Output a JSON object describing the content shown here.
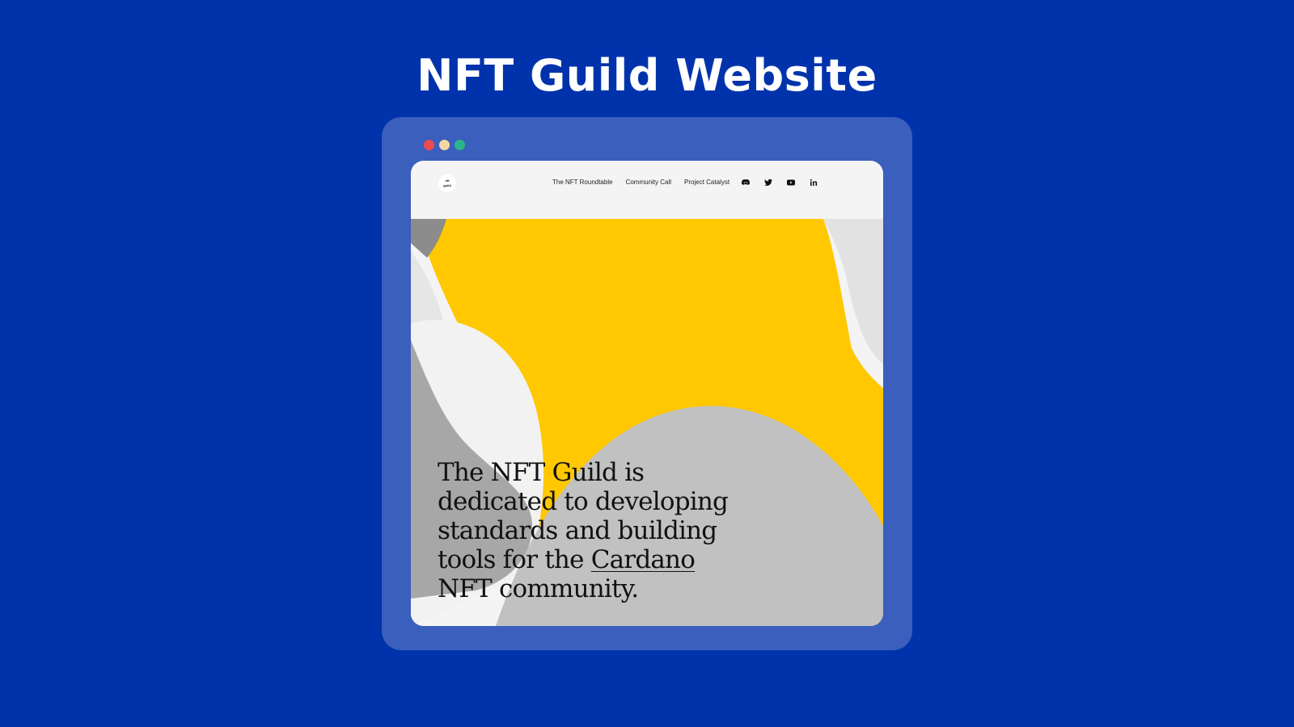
{
  "page": {
    "title": "NFT Guild Website"
  },
  "window": {
    "dot_colors": [
      "#ef4b4b",
      "#f6d7a3",
      "#2bb38b"
    ]
  },
  "site": {
    "logo_text": "nft guild",
    "nav": [
      {
        "label": "The NFT Roundtable"
      },
      {
        "label": "Community Call"
      },
      {
        "label": "Project Catalyst"
      }
    ],
    "social_icons": [
      "discord-icon",
      "twitter-icon",
      "youtube-icon",
      "linkedin-icon"
    ]
  },
  "hero": {
    "text_before": "The NFT Guild is dedicated to developing standards and building tools for the ",
    "link_text": "Cardano",
    "text_after": " NFT community."
  },
  "colors": {
    "background": "#0033ab",
    "frame": "#3a5fbd",
    "yellow": "#ffc800",
    "gray_mid": "#a7a7a7",
    "gray_light": "#c1c1c1",
    "gray_dark": "#8c8c8c",
    "off_white": "#f4f4f4"
  }
}
